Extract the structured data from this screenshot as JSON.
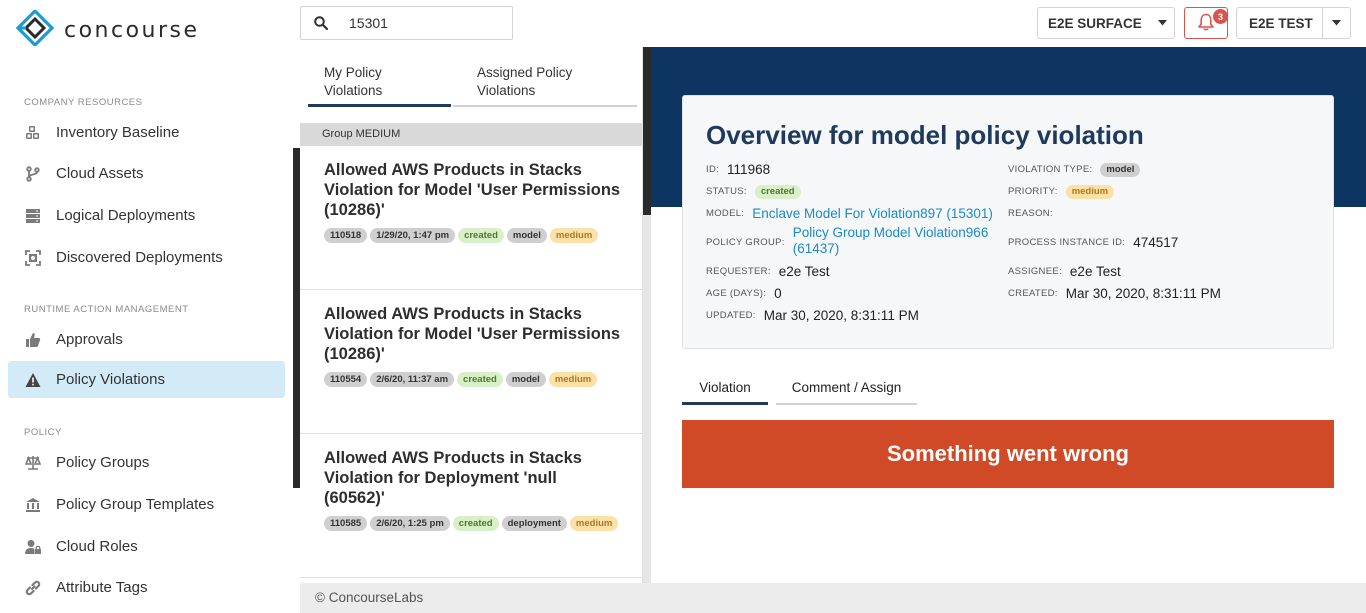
{
  "app": {
    "brand": "concourse",
    "footer": "© ConcourseLabs"
  },
  "search": {
    "value": "15301"
  },
  "topbar": {
    "environment": "E2E SURFACE",
    "notifications_count": "3",
    "user": "E2E TEST"
  },
  "sidebar": {
    "sections": [
      {
        "title": "COMPANY RESOURCES"
      },
      {
        "title": "RUNTIME ACTION MANAGEMENT"
      },
      {
        "title": "POLICY"
      }
    ],
    "items": [
      {
        "label": "Inventory Baseline",
        "icon": "cubes-icon"
      },
      {
        "label": "Cloud Assets",
        "icon": "branch-icon"
      },
      {
        "label": "Logical Deployments",
        "icon": "server-icon"
      },
      {
        "label": "Discovered Deployments",
        "icon": "scan-icon"
      },
      {
        "label": "Approvals",
        "icon": "thumbs-up-icon"
      },
      {
        "label": "Policy Violations",
        "icon": "warning-icon",
        "active": true
      },
      {
        "label": "Policy Groups",
        "icon": "scale-icon"
      },
      {
        "label": "Policy Group Templates",
        "icon": "bank-icon"
      },
      {
        "label": "Cloud Roles",
        "icon": "user-lock-icon"
      },
      {
        "label": "Attribute Tags",
        "icon": "link-icon"
      }
    ]
  },
  "list": {
    "tabs": [
      "My Policy Violations",
      "Assigned Policy Violations"
    ],
    "group_header": "Group MEDIUM",
    "cards": [
      {
        "title": "Allowed AWS Products in Stacks Violation for Model 'User Permissions (10286)'",
        "id": "110518",
        "date": "1/29/20, 1:47 pm",
        "status": "created",
        "type": "model",
        "priority": "medium"
      },
      {
        "title": "Allowed AWS Products in Stacks Violation for Model 'User Permissions (10286)'",
        "id": "110554",
        "date": "2/6/20, 11:37 am",
        "status": "created",
        "type": "model",
        "priority": "medium"
      },
      {
        "title": "Allowed AWS Products in Stacks Violation for Deployment 'null (60562)'",
        "id": "110585",
        "date": "2/6/20, 1:25 pm",
        "status": "created",
        "type": "deployment",
        "priority": "medium"
      }
    ]
  },
  "overview": {
    "title": "Overview for model policy violation",
    "labels": {
      "id": "ID:",
      "status": "STATUS:",
      "model": "MODEL:",
      "policy_group": "POLICY GROUP:",
      "requester": "REQUESTER:",
      "age": "AGE (DAYS):",
      "updated": "UPDATED:",
      "violation_type": "VIOLATION TYPE:",
      "priority": "PRIORITY:",
      "reason": "REASON:",
      "process_instance_id": "PROCESS INSTANCE ID:",
      "assignee": "ASSIGNEE:",
      "created": "CREATED:"
    },
    "values": {
      "id": "111968",
      "status": "created",
      "model": "Enclave Model For Violation897 (15301)",
      "policy_group": "Policy Group Model Violation966 (61437)",
      "requester": "e2e Test",
      "age": "0",
      "updated": "Mar 30, 2020, 8:31:11 PM",
      "violation_type": "model",
      "priority": "medium",
      "reason": "",
      "process_instance_id": "474517",
      "assignee": "e2e Test",
      "created": "Mar 30, 2020, 8:31:11 PM"
    }
  },
  "detail_tabs": [
    "Violation",
    "Comment / Assign"
  ],
  "error_message": "Something went wrong",
  "colors": {
    "navy": "#0e3561",
    "active_nav": "#d2ebf6",
    "error": "#d04a27",
    "link": "#1a8ac8",
    "alert": "#d9534f"
  }
}
